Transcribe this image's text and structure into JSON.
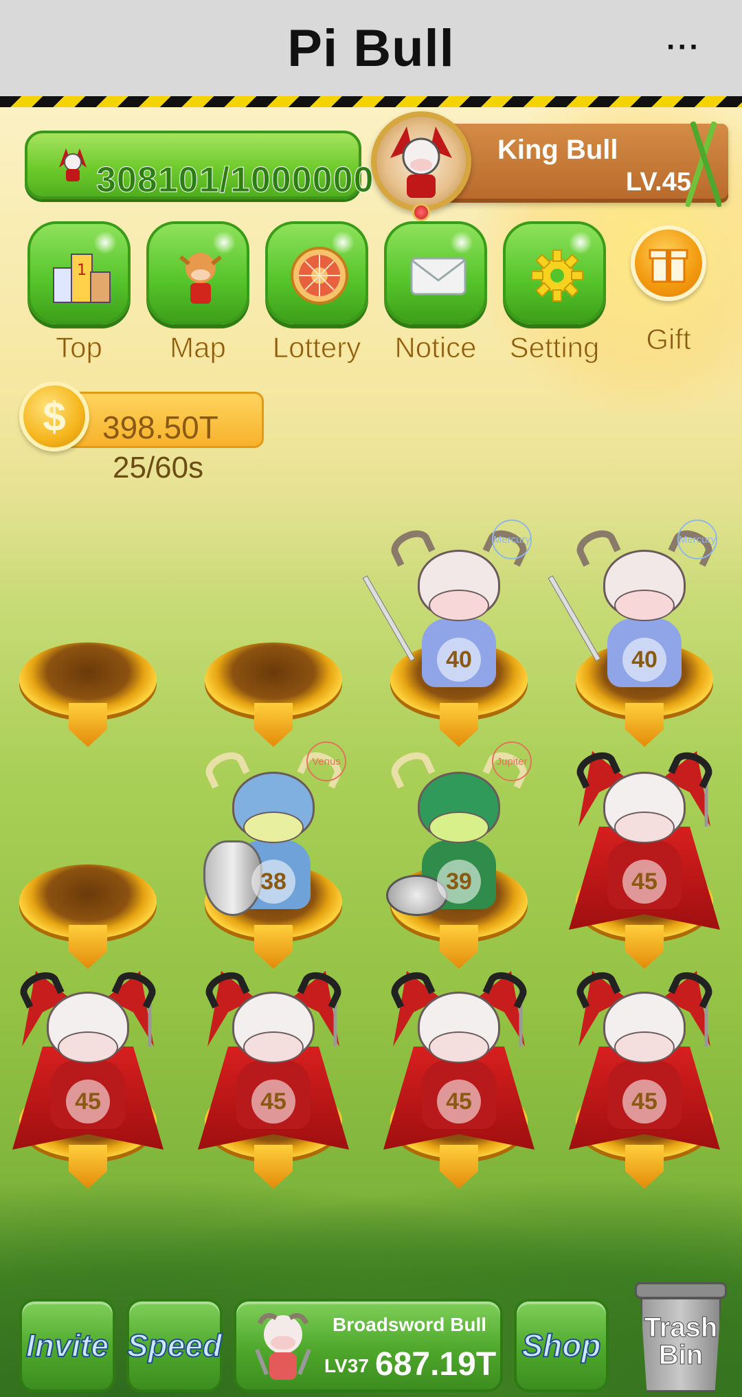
{
  "header": {
    "title": "Pi Bull",
    "more_label": "···"
  },
  "player": {
    "xp": "308101/1000000",
    "rank_name": "King Bull",
    "rank_level": "LV.45"
  },
  "menu": [
    {
      "id": "top",
      "label": "Top",
      "icon": "podium-icon"
    },
    {
      "id": "map",
      "label": "Map",
      "icon": "bull-map-icon"
    },
    {
      "id": "lottery",
      "label": "Lottery",
      "icon": "wheel-icon"
    },
    {
      "id": "notice",
      "label": "Notice",
      "icon": "envelope-icon"
    },
    {
      "id": "setting",
      "label": "Setting",
      "icon": "gear-icon"
    },
    {
      "id": "gift",
      "label": "Gift",
      "icon": "gift-icon"
    }
  ],
  "coins": {
    "amount": "398.50T",
    "timer": "25/60s"
  },
  "grid": [
    {
      "row": 1,
      "col": 1,
      "occupied": false
    },
    {
      "row": 1,
      "col": 2,
      "occupied": false
    },
    {
      "row": 1,
      "col": 3,
      "occupied": true,
      "level": "40",
      "kind": "sword",
      "planet": "Mercury"
    },
    {
      "row": 1,
      "col": 4,
      "occupied": true,
      "level": "40",
      "kind": "sword",
      "planet": "Mercury"
    },
    {
      "row": 2,
      "col": 1,
      "occupied": false
    },
    {
      "row": 2,
      "col": 2,
      "occupied": true,
      "level": "38",
      "kind": "shield",
      "planet": "Venus"
    },
    {
      "row": 2,
      "col": 3,
      "occupied": true,
      "level": "39",
      "kind": "axe",
      "planet": "Jupiter"
    },
    {
      "row": 2,
      "col": 4,
      "occupied": true,
      "level": "45",
      "kind": "king"
    },
    {
      "row": 3,
      "col": 1,
      "occupied": true,
      "level": "45",
      "kind": "king"
    },
    {
      "row": 3,
      "col": 2,
      "occupied": true,
      "level": "45",
      "kind": "king"
    },
    {
      "row": 3,
      "col": 3,
      "occupied": true,
      "level": "45",
      "kind": "king"
    },
    {
      "row": 3,
      "col": 4,
      "occupied": true,
      "level": "45",
      "kind": "king"
    }
  ],
  "bottom": {
    "invite": "Invite",
    "speed": "Speed",
    "buy": {
      "name": "Broadsword Bull",
      "level": "LV37",
      "price": "687.19T"
    },
    "shop": "Shop",
    "trash": "Trash\nBin"
  },
  "colors": {
    "green": "#55c32a",
    "gold": "#f7b22c",
    "brown": "#8a5a14"
  }
}
